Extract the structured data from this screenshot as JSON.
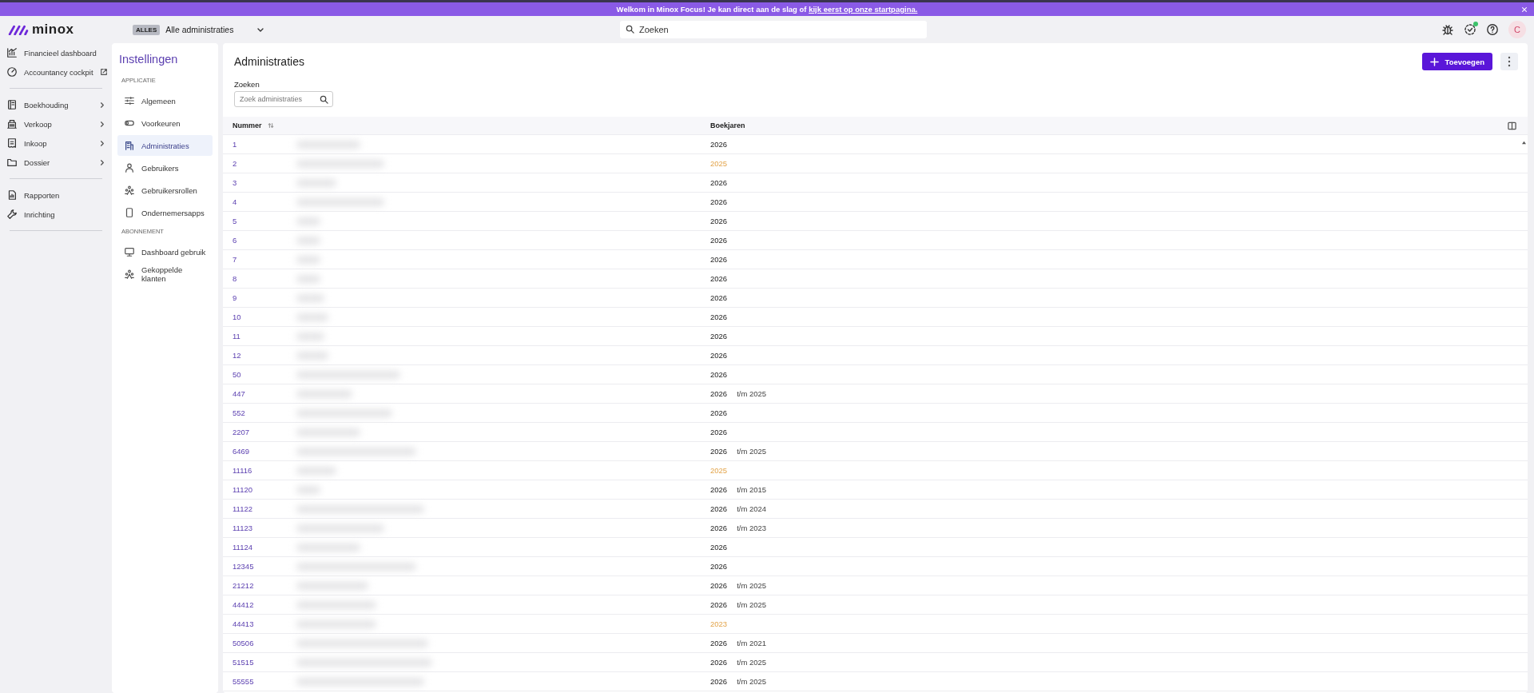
{
  "banner": {
    "text": "Welkom in Minox Focus! Je kan direct aan de slag of ",
    "link": "kijk eerst op onze startpagina."
  },
  "header": {
    "logo": "minox",
    "scope_badge": "ALLES",
    "scope": "Alle administraties",
    "search": {
      "placeholder": "Zoeken"
    },
    "avatar": "C",
    "notification": true
  },
  "nav": {
    "groups": [
      [
        {
          "label": "Financieel dashboard",
          "external": false,
          "submenu": false
        },
        {
          "label": "Accountancy cockpit",
          "external": true,
          "submenu": false
        }
      ],
      [
        {
          "label": "Boekhouding",
          "external": false,
          "submenu": true
        },
        {
          "label": "Verkoop",
          "external": false,
          "submenu": true
        },
        {
          "label": "Inkoop",
          "external": false,
          "submenu": true
        },
        {
          "label": "Dossier",
          "external": false,
          "submenu": true
        }
      ],
      [
        {
          "label": "Rapporten",
          "external": false,
          "submenu": false
        },
        {
          "label": "Inrichting",
          "external": false,
          "submenu": false
        }
      ]
    ]
  },
  "settings": {
    "title": "Instellingen",
    "sections": [
      {
        "heading": "APPLICATIE",
        "items": [
          {
            "label": "Algemeen",
            "selected": false
          },
          {
            "label": "Voorkeuren",
            "selected": false
          },
          {
            "label": "Administraties",
            "selected": true
          },
          {
            "label": "Gebruikers",
            "selected": false
          },
          {
            "label": "Gebruikersrollen",
            "selected": false
          },
          {
            "label": "Ondernemersapps",
            "selected": false
          }
        ]
      },
      {
        "heading": "ABONNEMENT",
        "items": [
          {
            "label": "Dashboard gebruik",
            "selected": false
          },
          {
            "label": "Gekoppelde klanten",
            "selected": false
          }
        ]
      }
    ]
  },
  "main": {
    "title": "Administraties",
    "add_button": "Toevoegen",
    "search_label": "Zoeken",
    "search_placeholder": "Zoek administraties",
    "table": {
      "columns": [
        "Nummer",
        "Boekjaren"
      ],
      "rows": [
        {
          "nummer": "1",
          "year": "2026",
          "outdated": false
        },
        {
          "nummer": "2",
          "year": "2025",
          "outdated": true
        },
        {
          "nummer": "3",
          "year": "2026",
          "outdated": false
        },
        {
          "nummer": "4",
          "year": "2026",
          "outdated": false
        },
        {
          "nummer": "5",
          "year": "2026",
          "outdated": false
        },
        {
          "nummer": "6",
          "year": "2026",
          "outdated": false
        },
        {
          "nummer": "7",
          "year": "2026",
          "outdated": false
        },
        {
          "nummer": "8",
          "year": "2026",
          "outdated": false
        },
        {
          "nummer": "9",
          "year": "2026",
          "outdated": false
        },
        {
          "nummer": "10",
          "year": "2026",
          "outdated": false
        },
        {
          "nummer": "11",
          "year": "2026",
          "outdated": false
        },
        {
          "nummer": "12",
          "year": "2026",
          "outdated": false
        },
        {
          "nummer": "50",
          "year": "2026",
          "outdated": false
        },
        {
          "nummer": "447",
          "year": "2026",
          "range": "t/m 2025",
          "outdated": false
        },
        {
          "nummer": "552",
          "year": "2026",
          "outdated": false
        },
        {
          "nummer": "2207",
          "year": "2026",
          "outdated": false
        },
        {
          "nummer": "6469",
          "year": "2026",
          "range": "t/m 2025",
          "outdated": false
        },
        {
          "nummer": "11116",
          "year": "2025",
          "outdated": true
        },
        {
          "nummer": "11120",
          "year": "2026",
          "range": "t/m 2015",
          "outdated": false
        },
        {
          "nummer": "11122",
          "year": "2026",
          "range": "t/m 2024",
          "outdated": false
        },
        {
          "nummer": "11123",
          "year": "2026",
          "range": "t/m 2023",
          "outdated": false
        },
        {
          "nummer": "11124",
          "year": "2026",
          "outdated": false
        },
        {
          "nummer": "12345",
          "year": "2026",
          "outdated": false
        },
        {
          "nummer": "21212",
          "year": "2026",
          "range": "t/m 2025",
          "outdated": false
        },
        {
          "nummer": "44412",
          "year": "2026",
          "range": "t/m 2025",
          "outdated": false
        },
        {
          "nummer": "44413",
          "year": "2023",
          "outdated": true
        },
        {
          "nummer": "50506",
          "year": "2026",
          "range": "t/m 2021",
          "outdated": false
        },
        {
          "nummer": "51515",
          "year": "2026",
          "range": "t/m 2025",
          "outdated": false
        },
        {
          "nummer": "55555",
          "year": "2026",
          "range": "t/m 2025",
          "outdated": false
        }
      ]
    }
  }
}
